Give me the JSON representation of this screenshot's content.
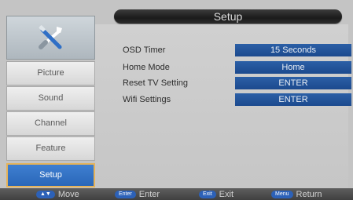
{
  "header": {
    "title": "Setup"
  },
  "rail": {
    "icon": "tools-icon",
    "items": [
      {
        "label": "Picture"
      },
      {
        "label": "Sound"
      },
      {
        "label": "Channel"
      },
      {
        "label": "Feature"
      },
      {
        "label": "Setup",
        "active": true
      }
    ]
  },
  "settings": [
    {
      "label": "OSD Timer",
      "value": "15 Seconds"
    },
    {
      "label": "Home Mode",
      "value": "Home"
    },
    {
      "label": "Reset TV Setting",
      "value": "ENTER"
    },
    {
      "label": "Wifi Settings",
      "value": "ENTER"
    }
  ],
  "footer": [
    {
      "key": "▲▼",
      "label": "Move"
    },
    {
      "key": "Enter",
      "label": "Enter"
    },
    {
      "key": "Exit",
      "label": "Exit"
    },
    {
      "key": "Menu",
      "label": "Return"
    }
  ],
  "colors": {
    "accent": "#2b5fa6",
    "active_border": "#e5b35a"
  }
}
